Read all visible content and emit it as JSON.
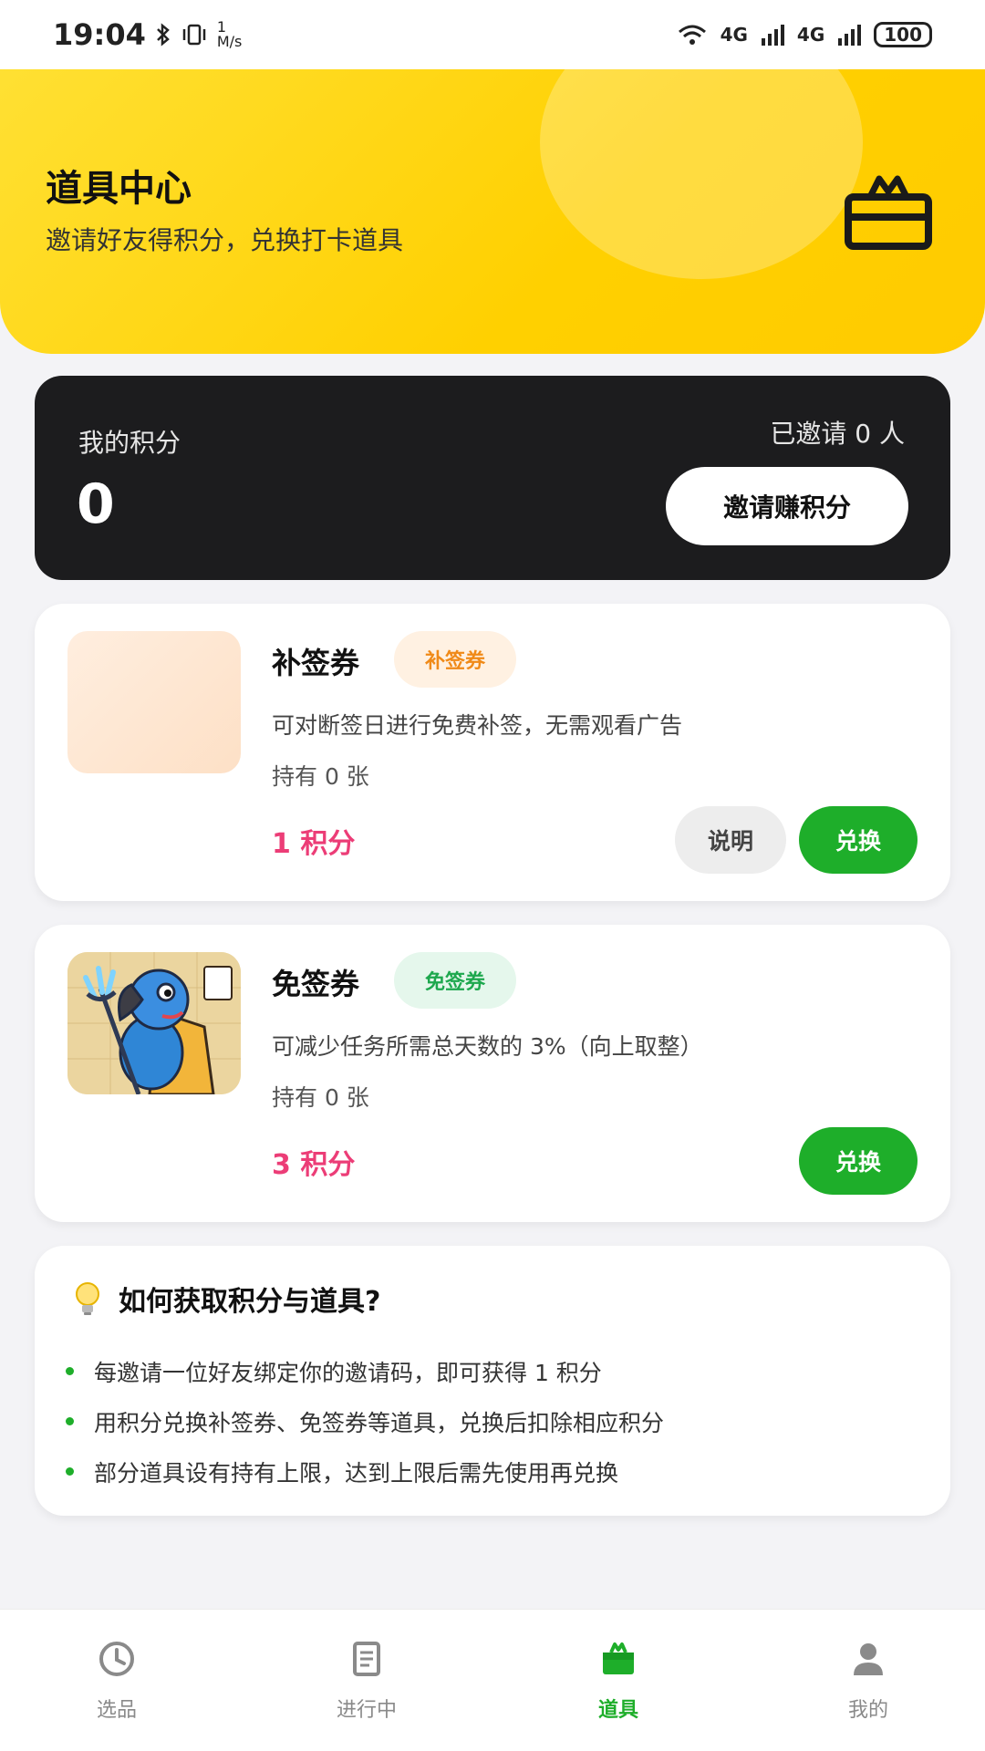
{
  "status_bar": {
    "time": "19:04",
    "net_speed_top": "1",
    "net_speed_unit": "M/s",
    "signal1": "4G",
    "signal2": "4G",
    "battery": "100"
  },
  "header": {
    "title": "道具中心",
    "subtitle": "邀请好友得积分，兑换打卡道具",
    "icon": "gift-icon"
  },
  "points": {
    "label": "我的积分",
    "value": "0",
    "invited_text": "已邀请 0 人",
    "invite_button": "邀请赚积分"
  },
  "items": [
    {
      "name": "补签券",
      "tag": "补签券",
      "tag_color": "#f08a18",
      "tag_bg": "#fff1e2",
      "description": "可对断签日进行免费补签，无需观看广告",
      "owned": "持有 0 张",
      "cost": "1 积分",
      "info_button": "说明",
      "redeem_button": "兑换"
    },
    {
      "name": "免签券",
      "tag": "免签券",
      "tag_color": "#1ea84e",
      "tag_bg": "#e5f7ec",
      "description": "可减少任务所需总天数的 3%（向上取整）",
      "owned": "持有 0 张",
      "cost": "3 积分",
      "redeem_button": "兑换"
    }
  ],
  "help": {
    "icon": "lightbulb-icon",
    "title": "如何获取积分与道具?",
    "points": [
      "每邀请一位好友绑定你的邀请码，即可获得 1 积分",
      "用积分兑换补签券、免签券等道具，兑换后扣除相应积分",
      "部分道具设有持有上限，达到上限后需先使用再兑换"
    ]
  },
  "nav": {
    "items": [
      {
        "label": "选品",
        "icon": "clock-icon"
      },
      {
        "label": "进行中",
        "icon": "document-icon"
      },
      {
        "label": "道具",
        "icon": "gift-icon"
      },
      {
        "label": "我的",
        "icon": "user-icon"
      }
    ],
    "active": "道具"
  },
  "colors": {
    "accent_yellow": "#ffd000",
    "accent_green": "#1eae2a",
    "cost_pink": "#ec3d77",
    "dark_card": "#1c1c1e"
  }
}
